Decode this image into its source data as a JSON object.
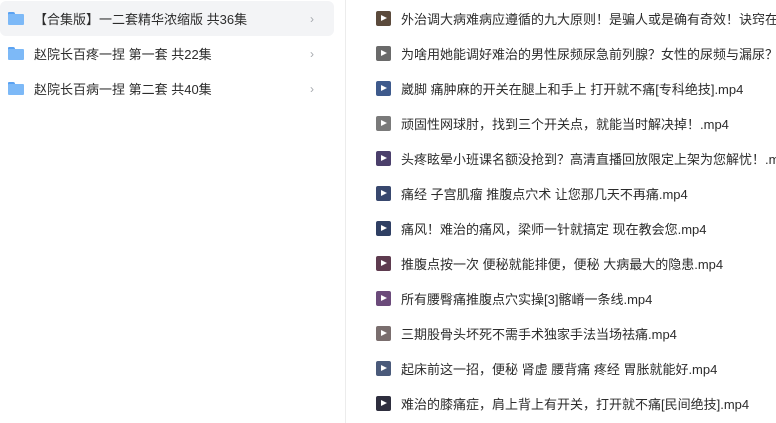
{
  "folders": [
    {
      "label": "【合集版】一二套精华浓缩版 共36集",
      "selected": true
    },
    {
      "label": "赵院长百疼一捏 第一套 共22集",
      "selected": false
    },
    {
      "label": "赵院长百病一捏 第二套 共40集",
      "selected": false
    }
  ],
  "folder_chevron": "›",
  "files": [
    {
      "name": "外治调大病难病应遵循的九大原则！是骗人或是确有奇效！诀窍在",
      "icon": "video-file-icon",
      "thumb": "#5b4a3c"
    },
    {
      "name": "为啥用她能调好难治的男性尿频尿急前列腺？女性的尿频与漏尿？",
      "icon": "video-file-icon",
      "thumb": "#6a6a6a"
    },
    {
      "name": "崴脚 痛肿麻的开关在腿上和手上 打开就不痛[专科绝技].mp4",
      "icon": "video-file-icon",
      "thumb": "#3e5a8c"
    },
    {
      "name": "顽固性网球肘，找到三个开关点，就能当时解决掉！.mp4",
      "icon": "video-file-icon",
      "thumb": "#7a7a7a"
    },
    {
      "name": "头疼眩晕小班课名额没抢到？高清直播回放限定上架为您解忧！.m",
      "icon": "video-file-icon",
      "thumb": "#4b3f6b"
    },
    {
      "name": "痛经 子宫肌瘤 推腹点穴术 让您那几天不再痛.mp4",
      "icon": "video-file-icon",
      "thumb": "#38486e"
    },
    {
      "name": "痛风！难治的痛风，梁师一针就搞定  现在教会您.mp4",
      "icon": "video-file-icon",
      "thumb": "#2f3f63"
    },
    {
      "name": "推腹点按一次 便秘就能排便，便秘 大病最大的隐患.mp4",
      "icon": "video-file-icon",
      "thumb": "#5e3b4f"
    },
    {
      "name": "所有腰臀痛推腹点穴实操[3]髂嵴一条线.mp4",
      "icon": "video-file-icon",
      "thumb": "#6b4a7a"
    },
    {
      "name": "三期股骨头坏死不需手术独家手法当场祛痛.mp4",
      "icon": "video-file-icon",
      "thumb": "#7a6e6e"
    },
    {
      "name": "起床前这一招，便秘 肾虚 腰背痛  疼经 胃胀就能好.mp4",
      "icon": "video-file-icon",
      "thumb": "#4a5a7a"
    },
    {
      "name": "难治的膝痛症，肩上背上有开关，打开就不痛[民间绝技].mp4",
      "icon": "video-file-icon",
      "thumb": "#2e2e3e"
    }
  ]
}
